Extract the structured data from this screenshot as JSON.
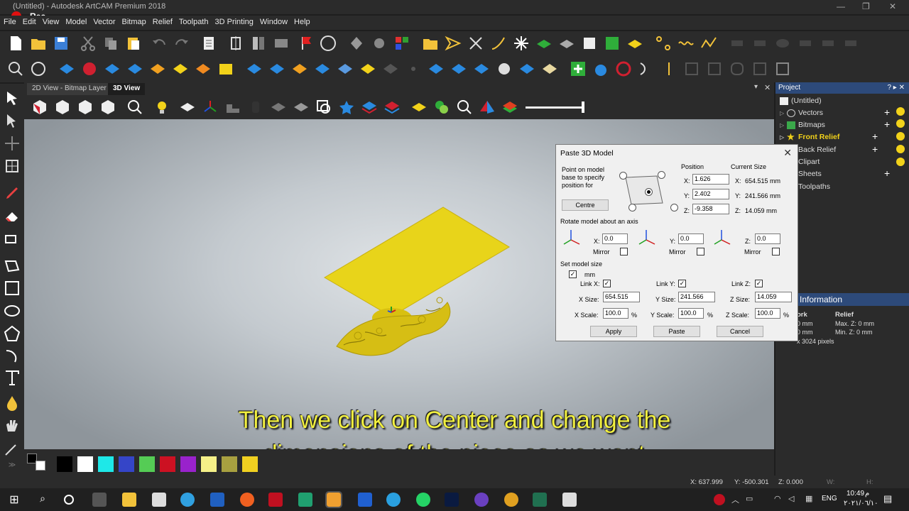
{
  "window": {
    "title": "(Untitled) - Autodesk ArtCAM Premium 2018",
    "recording_label": "Rec"
  },
  "menu": [
    "File",
    "Edit",
    "View",
    "Model",
    "Vector",
    "Bitmap",
    "Relief",
    "Toolpath",
    "3D Printing",
    "Window",
    "Help"
  ],
  "view_tabs": [
    {
      "label": "2D View - Bitmap Layer",
      "active": false
    },
    {
      "label": "3D View",
      "active": true
    }
  ],
  "project_panel": {
    "title": "Project",
    "header_controls": "? ▸ ✕",
    "tree": [
      {
        "label": "(Untitled)",
        "bold": false
      },
      {
        "label": "Vectors",
        "bold": false
      },
      {
        "label": "Bitmaps",
        "bold": false
      },
      {
        "label": "Front Relief",
        "bold": true
      },
      {
        "label": "Back Relief",
        "bold": false
      },
      {
        "label": "Clipart",
        "bold": false
      },
      {
        "label": "Sheets",
        "bold": false
      },
      {
        "label": "Toolpaths",
        "bold": false
      }
    ],
    "model_header": "odel",
    "info_header": "Information",
    "info_cols": [
      "ork",
      "Relief"
    ],
    "info_rows": [
      [
        "0 mm",
        "Max. Z: 0 mm"
      ],
      [
        "0 mm",
        "Min. Z: 0 mm"
      ]
    ],
    "info_pixels": "x 3024 pixels"
  },
  "dialog": {
    "title": "Paste 3D Model",
    "point_label": "Point on model base to specify position for",
    "centre_button": "Centre",
    "position_header": "Position",
    "current_size_header": "Current Size",
    "pos_x_label": "X:",
    "pos_x": "1.626",
    "size_x": "654.515 mm",
    "pos_y_label": "Y:",
    "pos_y": "2.402",
    "size_y": "241.566 mm",
    "pos_z_label": "Z:",
    "pos_z": "-9.358",
    "size_z": "14.059 mm",
    "size_x_prefix": "X:",
    "size_y_prefix": "Y:",
    "size_z_prefix": "Z:",
    "rotate_header": "Rotate model about an axis",
    "rot_x_label": "X:",
    "rot_x": "0.0",
    "rot_y_label": "Y:",
    "rot_y": "0.0",
    "rot_z_label": "Z:",
    "rot_z": "0.0",
    "mirror_label": "Mirror",
    "set_size_header": "Set model size",
    "mm_label": "mm",
    "link_x_label": "Link X:",
    "link_y_label": "Link Y:",
    "link_z_label": "Link Z:",
    "x_size_label": "X Size:",
    "x_size": "654.515",
    "y_size_label": "Y Size:",
    "y_size": "241.566",
    "z_size_label": "Z Size:",
    "z_size": "14.059",
    "x_scale_label": "X Scale:",
    "x_scale": "100.0",
    "y_scale_label": "Y Scale:",
    "y_scale": "100.0",
    "z_scale_label": "Z Scale:",
    "z_scale": "100.0",
    "percent": "%",
    "apply_button": "Apply",
    "paste_button": "Paste",
    "cancel_button": "Cancel",
    "check_mark": "✓"
  },
  "caption": {
    "line1": "Then we click on Center and change the",
    "line2": "dimensions of the piece as we want"
  },
  "status": {
    "x": "X: 637.999",
    "y": "Y: -500.301",
    "z": "Z: 0.000",
    "w": "W:",
    "h": "H:"
  },
  "taskbar": {
    "language": "ENG",
    "time": "10:49",
    "date": "٢٠٢١/٠٦/١٠",
    "ampm": "م"
  },
  "palette_colors": [
    "#000000",
    "#ffffff",
    "#1ee8e8",
    "#3545c8",
    "#55cc55",
    "#cc1122",
    "#9922cc",
    "#f5f088",
    "#a8a040",
    "#f0d020"
  ],
  "colors": {
    "relief_yellow": "#e8d41a",
    "panel_header": "#2d4a7a",
    "caption_yellow": "#f2f040"
  }
}
